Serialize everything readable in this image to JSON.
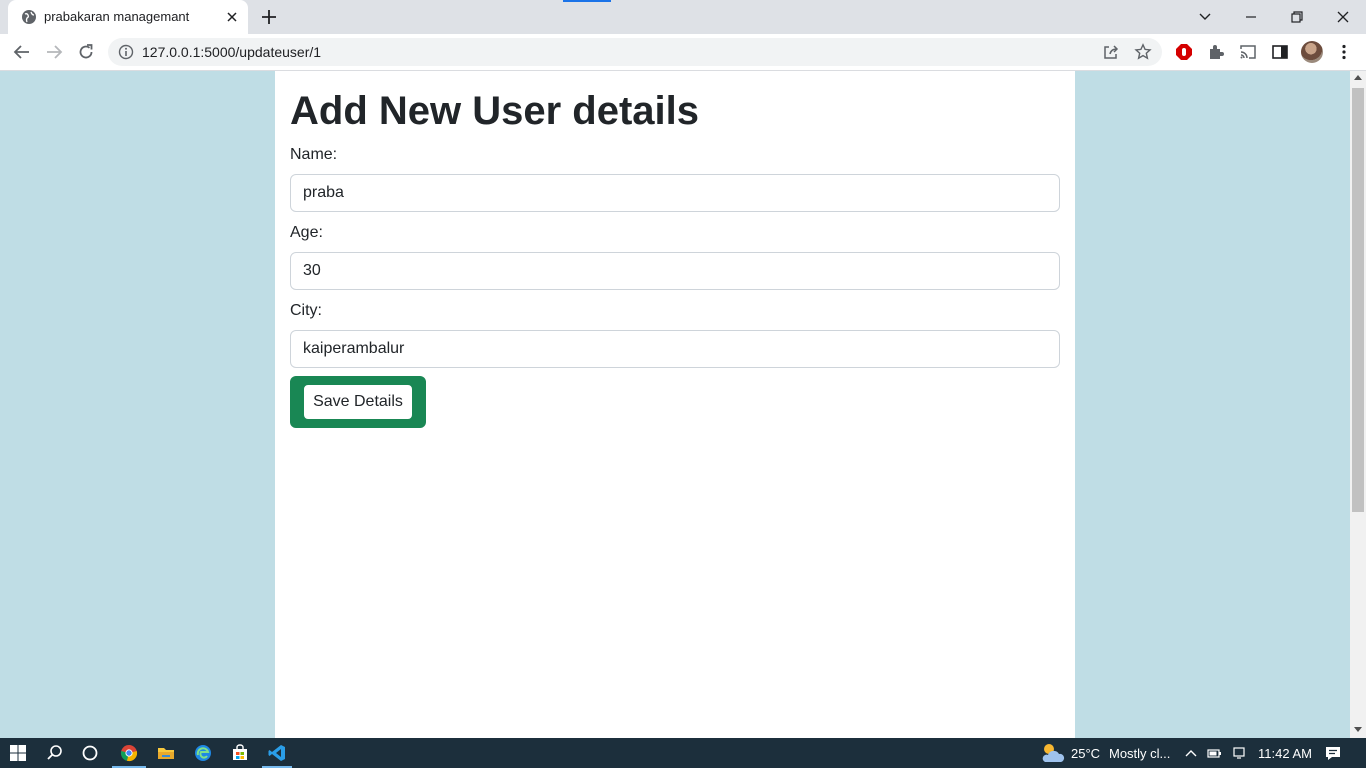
{
  "browser": {
    "tab_title": "prabakaran managemant",
    "url": "127.0.0.1:5000/updateuser/1"
  },
  "form": {
    "heading": "Add New User details",
    "name_label": "Name:",
    "name_value": "praba",
    "age_label": "Age:",
    "age_value": "30",
    "city_label": "City:",
    "city_value": "kaiperambalur",
    "save_label": "Save Details"
  },
  "colors": {
    "page_background": "#bfdde5",
    "container_background": "#ffffff",
    "save_frame": "#198754",
    "taskbar": "#1c2f3c"
  },
  "taskbar": {
    "weather_temp": "25°C",
    "weather_desc": "Mostly cl...",
    "time": "11:42 AM",
    "pinned": [
      "windows-start-icon",
      "search-icon",
      "task-view-icon",
      "chrome-icon",
      "file-explorer-icon",
      "edge-icon",
      "store-icon",
      "vscode-icon"
    ]
  }
}
